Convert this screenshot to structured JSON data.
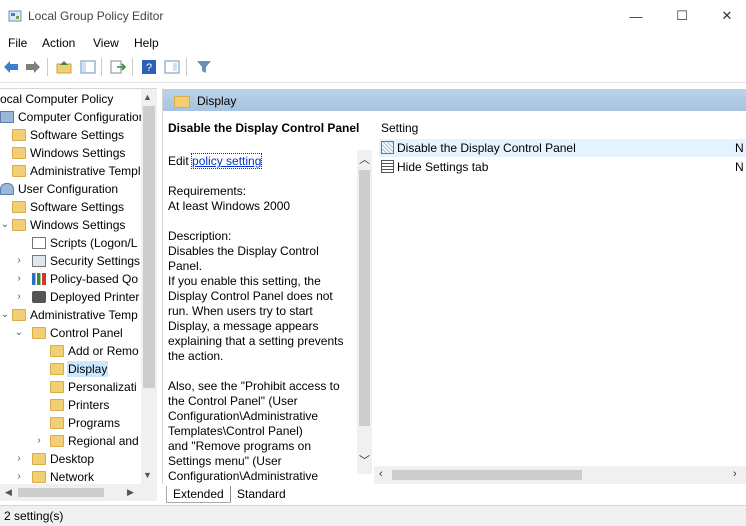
{
  "window": {
    "title": "Local Group Policy Editor",
    "minimize_glyph": "—",
    "maximize_glyph": "☐",
    "close_glyph": "✕"
  },
  "menu": [
    "File",
    "Action",
    "View",
    "Help"
  ],
  "tree": {
    "items": [
      {
        "label": "ocal Computer Policy"
      },
      {
        "label": "Computer Configuration"
      },
      {
        "label": "Software Settings"
      },
      {
        "label": "Windows Settings"
      },
      {
        "label": "Administrative Templ"
      },
      {
        "label": "User Configuration"
      },
      {
        "label": "Software Settings"
      },
      {
        "label": "Windows Settings"
      },
      {
        "label": "Scripts (Logon/L"
      },
      {
        "label": "Security Settings"
      },
      {
        "label": "Policy-based Qo"
      },
      {
        "label": "Deployed Printer"
      },
      {
        "label": "Administrative Temp"
      },
      {
        "label": "Control Panel"
      },
      {
        "label": "Add or Remo"
      },
      {
        "label": "Display"
      },
      {
        "label": "Personalizati"
      },
      {
        "label": "Printers"
      },
      {
        "label": "Programs"
      },
      {
        "label": "Regional and"
      },
      {
        "label": "Desktop"
      },
      {
        "label": "Network"
      }
    ]
  },
  "header": {
    "title": "Display"
  },
  "extended": {
    "title": "Disable the Display Control Panel",
    "edit_prefix": "Edit ",
    "edit_link": "policy setting",
    "req_label": "Requirements:",
    "req_value": "At least Windows 2000",
    "desc_label": "Description:",
    "desc_1": "Disables the Display Control Panel.",
    "desc_2_lines": [
      "If you enable this setting, the",
      "Display Control Panel does not",
      "run. When users try to start",
      "Display, a message appears",
      "explaining that a setting prevents",
      "the action."
    ],
    "desc_3_lines": [
      "Also, see the \"Prohibit access to",
      "the Control Panel\" (User",
      "Configuration\\Administrative",
      "Templates\\Control Panel)",
      "and \"Remove programs on",
      "Settings menu\" (User",
      "Configuration\\Administrative"
    ]
  },
  "list": {
    "column": "Setting",
    "rows": [
      {
        "name": "Disable the Display Control Panel",
        "state": "N"
      },
      {
        "name": "Hide Settings tab",
        "state": "N"
      }
    ]
  },
  "tabs": {
    "extended": "Extended",
    "standard": "Standard"
  },
  "status": {
    "text": "2 setting(s)"
  }
}
